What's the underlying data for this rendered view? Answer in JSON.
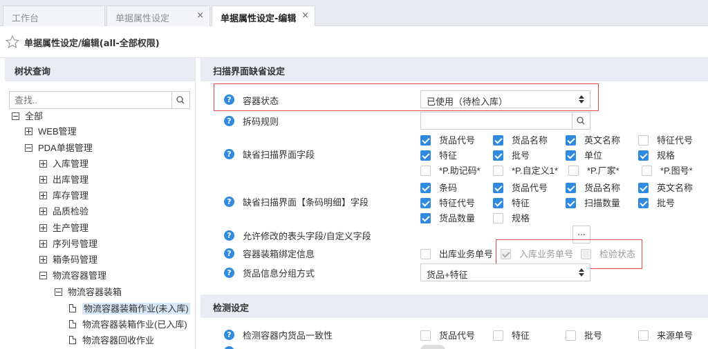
{
  "tabs": [
    {
      "label": "工作台",
      "closable": false,
      "active": false
    },
    {
      "label": "单据属性设定",
      "closable": true,
      "active": false
    },
    {
      "label": "单据属性设定-编辑",
      "closable": true,
      "active": true
    }
  ],
  "close_glyph": "×",
  "breadcrumb": {
    "icon": "star-icon",
    "text": "单据属性设定/编辑(all-全部权限)"
  },
  "left_panel": {
    "title": "树状查询",
    "search_placeholder": "查找..",
    "tree": [
      {
        "label": "全部",
        "state": "expanded"
      },
      {
        "label": "WEB管理",
        "state": "collapsed"
      },
      {
        "label": "PDA单据管理",
        "state": "expanded"
      },
      {
        "label": "入库管理",
        "state": "collapsed"
      },
      {
        "label": "出库管理",
        "state": "collapsed"
      },
      {
        "label": "库存管理",
        "state": "collapsed"
      },
      {
        "label": "品质检验",
        "state": "collapsed"
      },
      {
        "label": "生产管理",
        "state": "collapsed"
      },
      {
        "label": "序列号管理",
        "state": "collapsed"
      },
      {
        "label": "箱条码管理",
        "state": "collapsed"
      },
      {
        "label": "物流容器管理",
        "state": "expanded"
      },
      {
        "label": "物流容器装箱",
        "state": "expanded"
      },
      {
        "label": "物流容器装箱作业(未入库)",
        "state": "leaf",
        "selected": true
      },
      {
        "label": "物流容器装箱作业(已入库)",
        "state": "leaf"
      },
      {
        "label": "物流容器回收作业",
        "state": "leaf"
      }
    ]
  },
  "main": {
    "section1": {
      "title": "扫描界面缺省设定"
    },
    "rows": [
      {
        "label": "容器状态",
        "control": "select",
        "value": "已使用（待检入库）"
      },
      {
        "label": "拆码规则",
        "control": "text",
        "value": ""
      },
      {
        "label": "缺省扫描界面字段",
        "control": "checks",
        "items": [
          {
            "label": "货品代号",
            "checked": true
          },
          {
            "label": "货品名称",
            "checked": true
          },
          {
            "label": "英文名称",
            "checked": true
          },
          {
            "label": "特征代号",
            "checked": false
          },
          {
            "label": "特征",
            "checked": true
          },
          {
            "label": "批号",
            "checked": true
          },
          {
            "label": "单位",
            "checked": true
          },
          {
            "label": "规格",
            "checked": true
          },
          {
            "label": "*P.助记码*",
            "checked": false
          },
          {
            "label": "*P.自定义1*",
            "checked": false
          },
          {
            "label": "*P.厂家*",
            "checked": false
          },
          {
            "label": "*P.图号*",
            "checked": false
          }
        ]
      },
      {
        "label": "缺省扫描界面【条码明细】字段",
        "control": "checks",
        "items": [
          {
            "label": "条码",
            "checked": true
          },
          {
            "label": "货品代号",
            "checked": true
          },
          {
            "label": "货品名称",
            "checked": true
          },
          {
            "label": "英文名称",
            "checked": true
          },
          {
            "label": "特征代号",
            "checked": true
          },
          {
            "label": "特征",
            "checked": true
          },
          {
            "label": "扫描数量",
            "checked": true
          },
          {
            "label": "批号",
            "checked": true
          },
          {
            "label": "货品数量",
            "checked": true
          },
          {
            "label": "规格",
            "checked": false
          }
        ]
      },
      {
        "label": "允许修改的表头字段/自定义字段",
        "control": "ellipsis",
        "button": "..."
      },
      {
        "label": "容器装箱绑定信息",
        "control": "checks",
        "items": [
          {
            "label": "出库业务单号",
            "checked": false,
            "disabled": false
          },
          {
            "label": "入库业务单号",
            "checked": true,
            "disabled": true
          },
          {
            "label": "检验状态",
            "checked": false,
            "disabled": true
          }
        ]
      },
      {
        "label": "货品信息分组方式",
        "control": "select",
        "value": "货品+特征"
      }
    ],
    "section2": {
      "title": "检测设定"
    },
    "rows2": [
      {
        "label": "检测容器内货品一致性",
        "items": [
          {
            "label": "货品代号",
            "checked": false
          },
          {
            "label": "特征",
            "checked": false
          },
          {
            "label": "批号",
            "checked": false
          },
          {
            "label": "来源单号",
            "checked": false
          }
        ]
      }
    ],
    "help_glyph": "?"
  },
  "colors": {
    "accent": "#2f8ae0",
    "highlight_border": "#e04848",
    "header_bg": "#e9edf3"
  }
}
